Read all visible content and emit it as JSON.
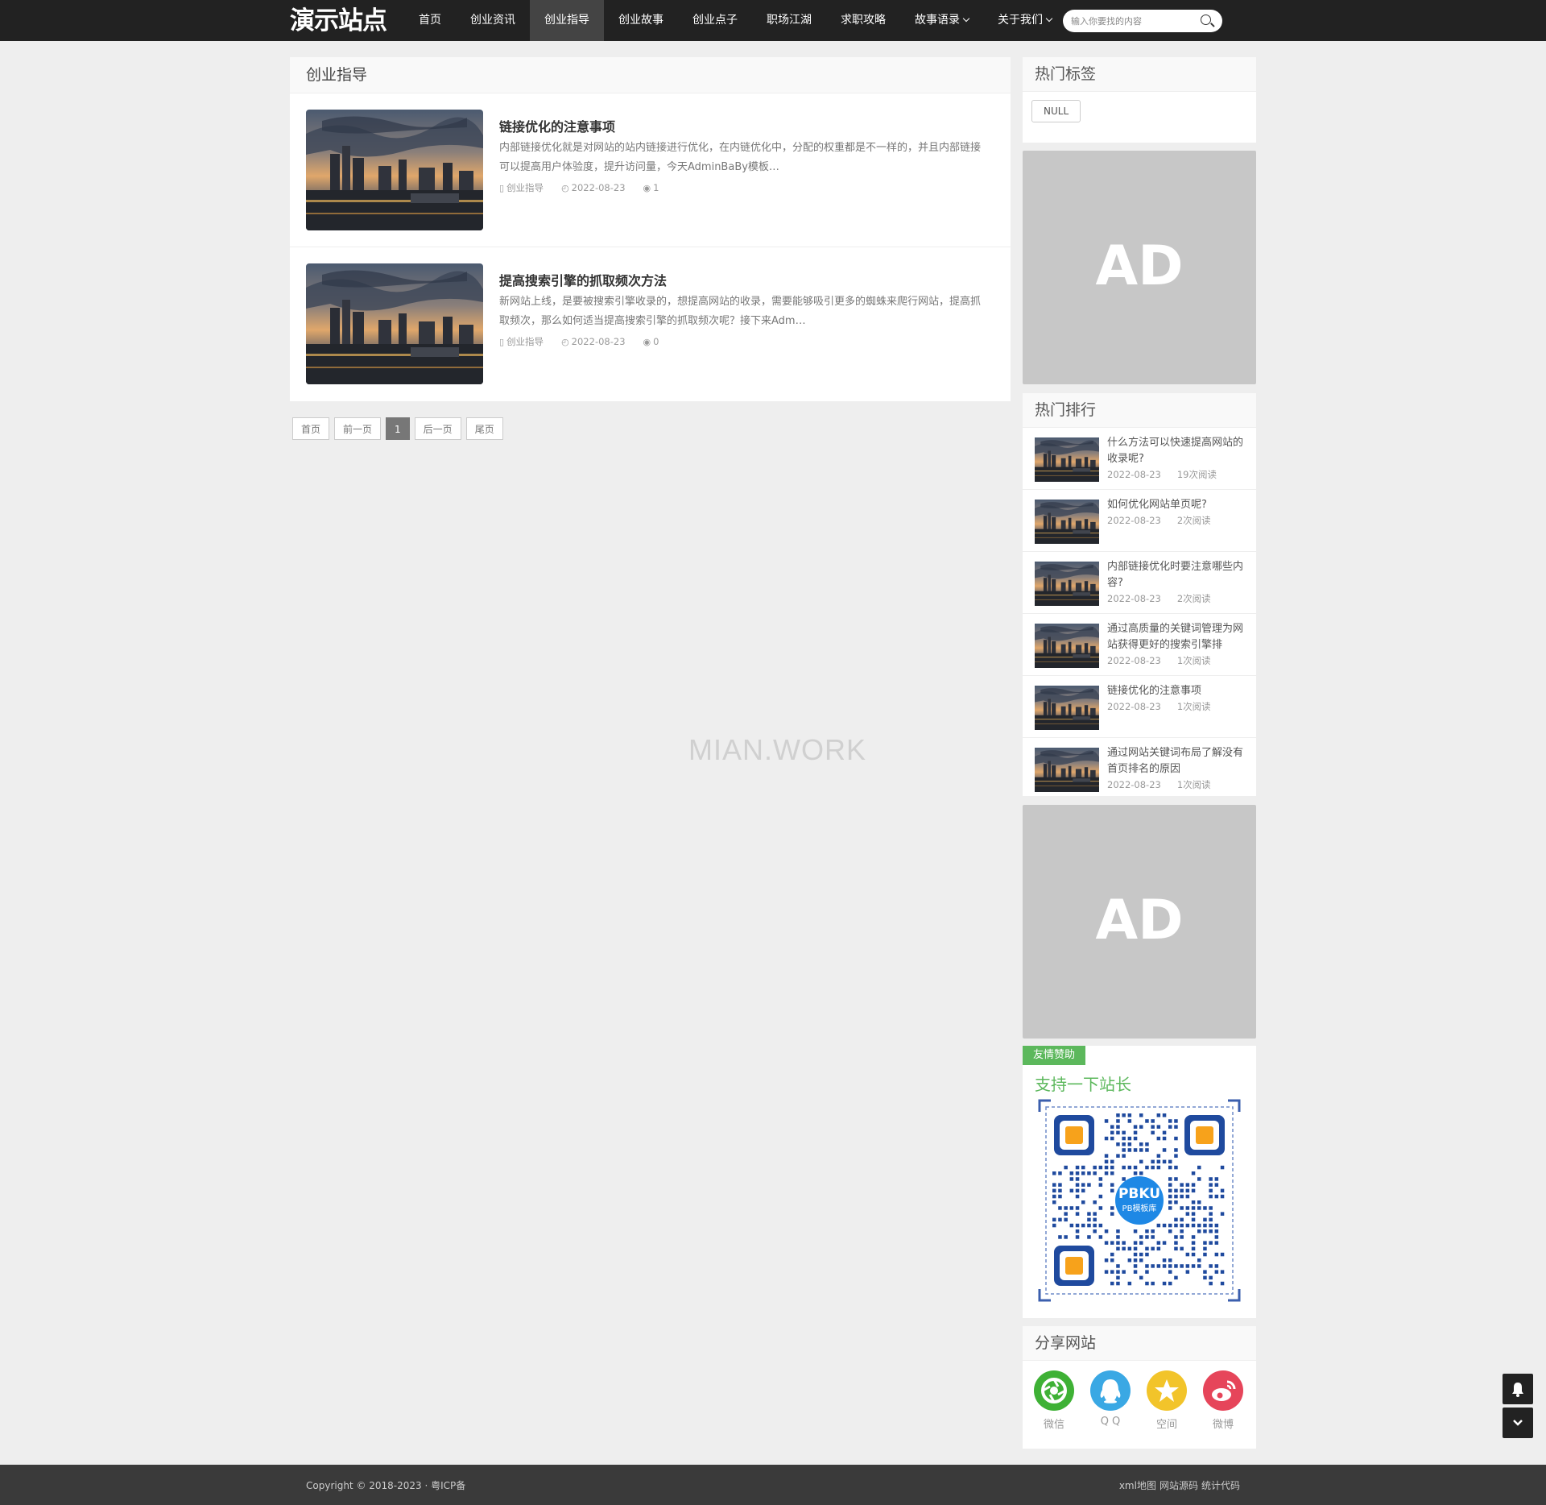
{
  "site": {
    "logo": "演示站点"
  },
  "nav": {
    "items": [
      {
        "label": "首页",
        "active": false,
        "dropdown": false
      },
      {
        "label": "创业资讯",
        "active": false,
        "dropdown": false
      },
      {
        "label": "创业指导",
        "active": true,
        "dropdown": false
      },
      {
        "label": "创业故事",
        "active": false,
        "dropdown": false
      },
      {
        "label": "创业点子",
        "active": false,
        "dropdown": false
      },
      {
        "label": "职场江湖",
        "active": false,
        "dropdown": false
      },
      {
        "label": "求职攻略",
        "active": false,
        "dropdown": false
      },
      {
        "label": "故事语录",
        "active": false,
        "dropdown": true
      },
      {
        "label": "关于我们",
        "active": false,
        "dropdown": true
      }
    ]
  },
  "search": {
    "placeholder": "输入你要找的内容",
    "value": ""
  },
  "main": {
    "title": "创业指导",
    "articles": [
      {
        "title": "链接优化的注意事项",
        "excerpt": "内部链接优化就是对网站的站内链接进行优化，在内链优化中，分配的权重都是不一样的，并且内部链接可以提高用户体验度，提升访问量，今天AdminBaBy模板…",
        "category": "创业指导",
        "date": "2022-08-23",
        "views": "1"
      },
      {
        "title": "提高搜索引擎的抓取频次方法",
        "excerpt": "新网站上线，是要被搜索引擎收录的，想提高网站的收录，需要能够吸引更多的蜘蛛来爬行网站，提高抓取频次，那么如何适当提高搜索引擎的抓取频次呢？接下来Adm…",
        "category": "创业指导",
        "date": "2022-08-23",
        "views": "0"
      }
    ],
    "pagination": {
      "first": "首页",
      "prev": "前一页",
      "current": "1",
      "next": "后一页",
      "last": "尾页"
    }
  },
  "watermark": "MIAN.WORK",
  "sidebar": {
    "tags": {
      "title": "热门标签",
      "items": [
        "NULL"
      ]
    },
    "ad1": {
      "label": "AD"
    },
    "rank": {
      "title": "热门排行",
      "items": [
        {
          "title": "什么方法可以快速提高网站的收录呢?",
          "date": "2022-08-23",
          "reads": "19次阅读"
        },
        {
          "title": "如何优化网站单页呢?",
          "date": "2022-08-23",
          "reads": "2次阅读"
        },
        {
          "title": "内部链接优化时要注意哪些内容?",
          "date": "2022-08-23",
          "reads": "2次阅读"
        },
        {
          "title": "通过高质量的关键词管理为网站获得更好的搜索引擎排",
          "date": "2022-08-23",
          "reads": "1次阅读"
        },
        {
          "title": "链接优化的注意事项",
          "date": "2022-08-23",
          "reads": "1次阅读"
        },
        {
          "title": "通过网站关键词布局了解没有首页排名的原因",
          "date": "2022-08-23",
          "reads": "1次阅读"
        }
      ]
    },
    "ad2": {
      "label": "AD"
    },
    "sponsor": {
      "badge": "友情赞助",
      "heading": "支持一下站长",
      "qr_center_line1": "PBKU",
      "qr_center_line2": "PB模板库"
    },
    "share": {
      "title": "分享网站",
      "items": [
        {
          "label": "微信",
          "color": "#3eb135",
          "icon": "wechat-icon"
        },
        {
          "label": "Q Q",
          "color": "#3aa8e4",
          "icon": "qq-icon"
        },
        {
          "label": "空间",
          "color": "#f2c42a",
          "icon": "star-icon"
        },
        {
          "label": "微博",
          "color": "#e6455a",
          "icon": "weibo-icon"
        }
      ]
    }
  },
  "footer": {
    "copyright": "Copyright © 2018-2023 · 粤ICP备",
    "links": [
      "xml地图",
      "网站源码",
      "统计代码"
    ]
  },
  "colors": {
    "topbar": "#222222",
    "accent_green": "#5cb85c",
    "footer": "#3a3a3a",
    "ad": "#c7c7c7"
  }
}
